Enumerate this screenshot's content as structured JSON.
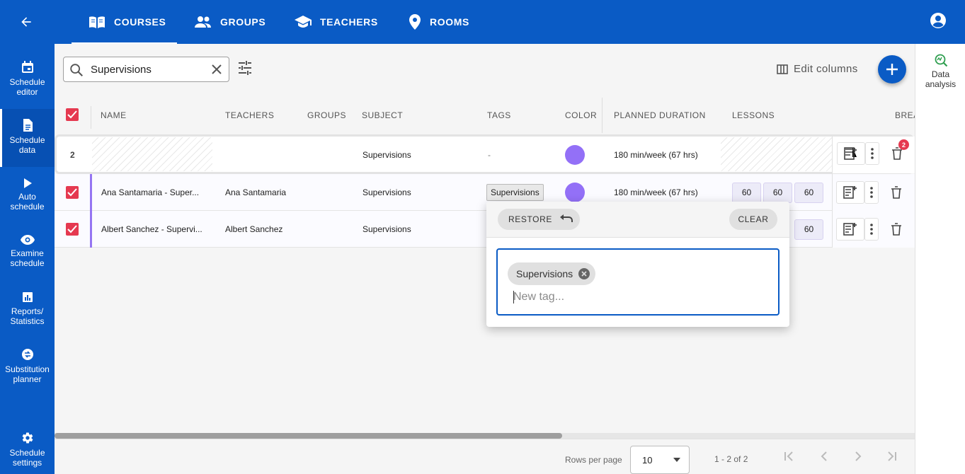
{
  "nav": {
    "tabs": [
      {
        "label": "COURSES",
        "icon": "book-open-icon"
      },
      {
        "label": "GROUPS",
        "icon": "people-icon"
      },
      {
        "label": "TEACHERS",
        "icon": "graduation-cap-icon"
      },
      {
        "label": "ROOMS",
        "icon": "location-pin-icon"
      }
    ],
    "active_tab": "COURSES"
  },
  "sidebar": {
    "items": [
      {
        "label": "Schedule editor",
        "icon": "calendar-icon"
      },
      {
        "label": "Schedule data",
        "icon": "document-icon"
      },
      {
        "label": "Auto schedule",
        "icon": "play-icon"
      },
      {
        "label": "Examine schedule",
        "icon": "eye-icon"
      },
      {
        "label": "Reports/ Statistics",
        "icon": "chart-icon"
      },
      {
        "label": "Substitution planner",
        "icon": "substitution-icon"
      },
      {
        "label": "Schedule settings",
        "icon": "gear-icon"
      }
    ],
    "active": "Schedule data"
  },
  "right_panel": {
    "label": "Data analysis",
    "icon": "data-analysis-icon"
  },
  "search": {
    "value": "Supervisions"
  },
  "toolbar": {
    "edit_columns": "Edit columns"
  },
  "columns": [
    "NAME",
    "TEACHERS",
    "GROUPS",
    "SUBJECT",
    "TAGS",
    "COLOR",
    "PLANNED DURATION",
    "LESSONS",
    "BREA"
  ],
  "group_row": {
    "count": "2",
    "subject": "Supervisions",
    "tags": "-",
    "duration": "180 min/week (67 hrs)",
    "delete_badge": "2"
  },
  "rows": [
    {
      "name": "Ana Santamaria - Super...",
      "teacher": "Ana Santamaria",
      "subject": "Supervisions",
      "tag": "Supervisions",
      "duration": "180 min/week (67 hrs)",
      "lessons": [
        "60",
        "60",
        "60"
      ]
    },
    {
      "name": "Albert Sanchez - Supervi...",
      "teacher": "Albert Sanchez",
      "subject": "Supervisions",
      "lessons": [
        "60"
      ]
    }
  ],
  "colors": {
    "primary": "#0a5bc5",
    "checkbox": "#e53950",
    "course_color": "#9370f7"
  },
  "pagination": {
    "rows_per_page_label": "Rows per page",
    "rows_per_page": "10",
    "range": "1 - 2 of 2"
  },
  "tag_editor": {
    "restore": "RESTORE",
    "clear": "CLEAR",
    "tags": [
      "Supervisions"
    ],
    "placeholder": "New tag..."
  }
}
